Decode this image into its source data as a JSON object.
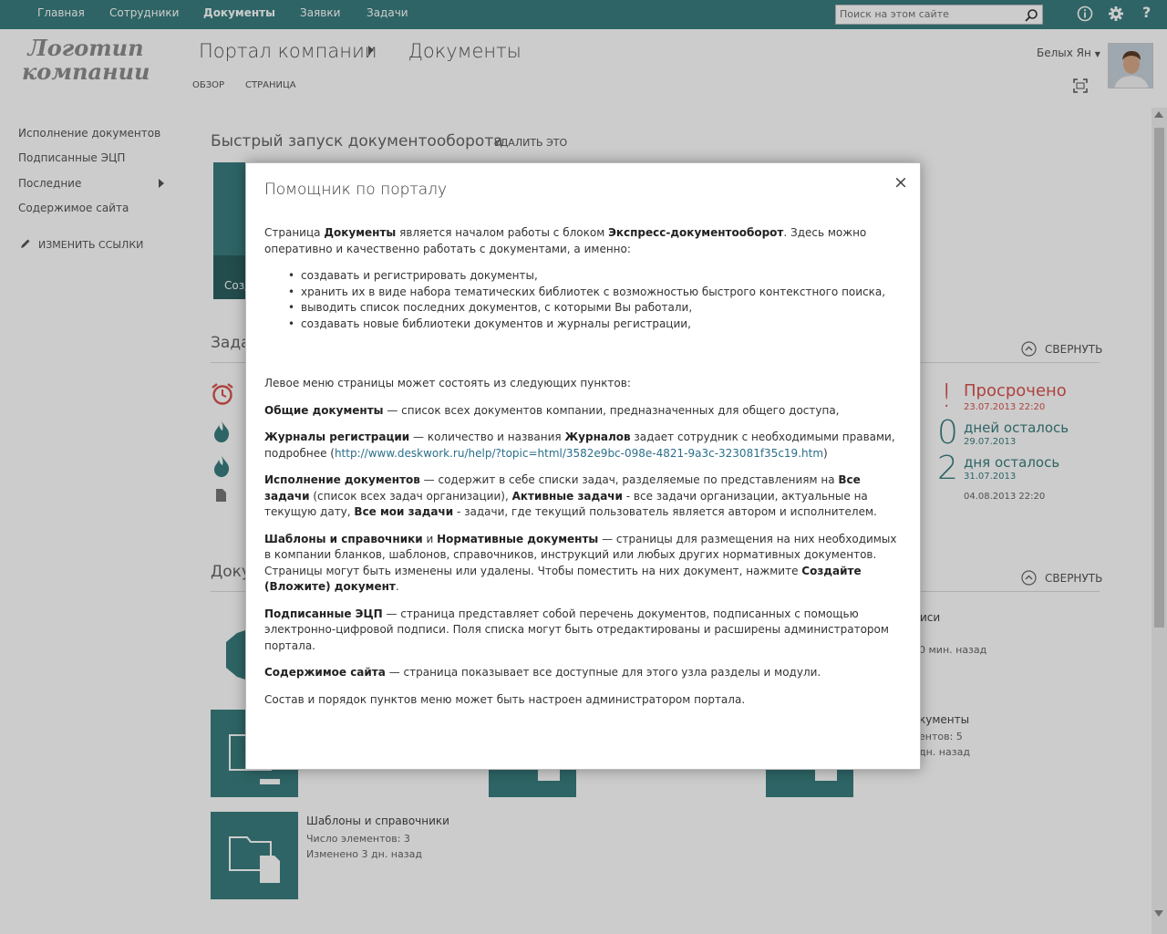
{
  "top_nav": {
    "items": [
      "Главная",
      "Сотрудники",
      "Документы",
      "Заявки",
      "Задачи"
    ],
    "active": "Документы",
    "search_placeholder": "Поиск на этом сайте"
  },
  "header": {
    "logo_line1": "Логотип",
    "logo_line2": "компании",
    "breadcrumb": [
      "Портал компании",
      "Документы"
    ],
    "tabs": [
      "ОБЗОР",
      "СТРАНИЦА"
    ],
    "user_name": "Белых Ян"
  },
  "left_nav": {
    "items": [
      "Исполнение документов",
      "Подписанные ЭЦП",
      "Последние",
      "Содержимое сайта"
    ],
    "edit_links": "ИЗМЕНИТЬ ССЫЛКИ"
  },
  "quick_launch": {
    "title": "Быстрый запуск документооборота",
    "remove": "УДАЛИТЬ ЭТО",
    "tile_caption": "Созд"
  },
  "tasks": {
    "title_fragment": "Зада",
    "collapse": "СВЕРНУТЬ",
    "statuses": [
      {
        "big": "!",
        "label": "Просрочено",
        "date": "23.07.2013 22:20",
        "color": "#d9534f"
      },
      {
        "big": "0",
        "label": "дней осталось",
        "date": "29.07.2013",
        "color": "#3a7e7f"
      },
      {
        "big": "2",
        "label": "дня осталось",
        "date": "31.07.2013",
        "color": "#3a7e7f"
      },
      {
        "big": "",
        "label": "",
        "date": "04.08.2013 22:20",
        "color": "#888"
      }
    ]
  },
  "documents": {
    "title_fragment": "Доку",
    "collapse": "СВЕРНУТЬ",
    "right_fragments": [
      "иси",
      "0 мин. назад",
      "кументы",
      "ентов: 5",
      "дн. назад"
    ],
    "template_tile": {
      "name": "Шаблоны и справочники",
      "count": "Число элементов: 3",
      "modified": "Изменено 3 дн. назад"
    }
  },
  "dialog": {
    "title": "Помощник по порталу",
    "close": "×",
    "intro_1": "Страница ",
    "intro_b1": "Документы",
    "intro_2": " является началом работы с блоком ",
    "intro_b2": "Экспресс-документооборот",
    "intro_3": ". Здесь можно оперативно и качественно работать с документами, а именно:",
    "bullets": [
      "создавать и регистрировать документы,",
      "хранить их в виде набора тематических библиотек с возможностью быстрого контекстного поиска,",
      "выводить список последних документов, с которыми Вы работали,",
      "создавать новые библиотеки документов и журналы регистрации,"
    ],
    "menu_intro": "Левое меню страницы может состоять из следующих пунктов:",
    "p1_b": "Общие документы",
    "p1": " — список всех документов компании, предназначенных для общего доступа,",
    "p2_b": "Журналы регистрации",
    "p2_a": " — количество и названия ",
    "p2_b2": "Журналов",
    "p2_c": " задает сотрудник с необходимыми правами, подробнее (",
    "p2_link": "http://www.deskwork.ru/help/?topic=html/3582e9bc-098e-4821-9a3c-323081f35c19.htm",
    "p2_d": ")",
    "p3_b": "Исполнение документов",
    "p3_a": " — содержит в себе списки задач, разделяемые по представлениям на ",
    "p3_b2": "Все задачи",
    "p3_c": " (список всех задач организации), ",
    "p3_b3": "Активные задачи",
    "p3_d": " - все задачи организации, актуальные на текущую дату, ",
    "p3_b4": "Все мои задачи",
    "p3_e": " - задачи, где текущий пользователь является автором и исполнителем.",
    "p4_b": "Шаблоны и справочники",
    "p4_a": " и ",
    "p4_b2": "Нормативные документы",
    "p4_c": " — страницы для размещения на них необходимых в компании бланков, шаблонов, справочников, инструкций или любых других нормативных документов. Страницы могут быть изменены или удалены. Чтобы поместить на них документ, нажмите ",
    "p4_b3": "Создайте (Вложите) документ",
    "p4_d": ".",
    "p5_b": "Подписанные ЭЦП",
    "p5": " — страница представляет собой перечень документов, подписанных с помощью электронно-цифровой подписи. Поля списка могут быть отредактированы и расширены администратором портала.",
    "p6_b": "Содержимое сайта",
    "p6": " — страница показывает все доступные для этого узла разделы и модули.",
    "footer": "Состав и порядок пунктов меню может быть настроен администратором портала."
  },
  "colors": {
    "accent": "#3a7e7f",
    "overdue": "#d9534f"
  }
}
